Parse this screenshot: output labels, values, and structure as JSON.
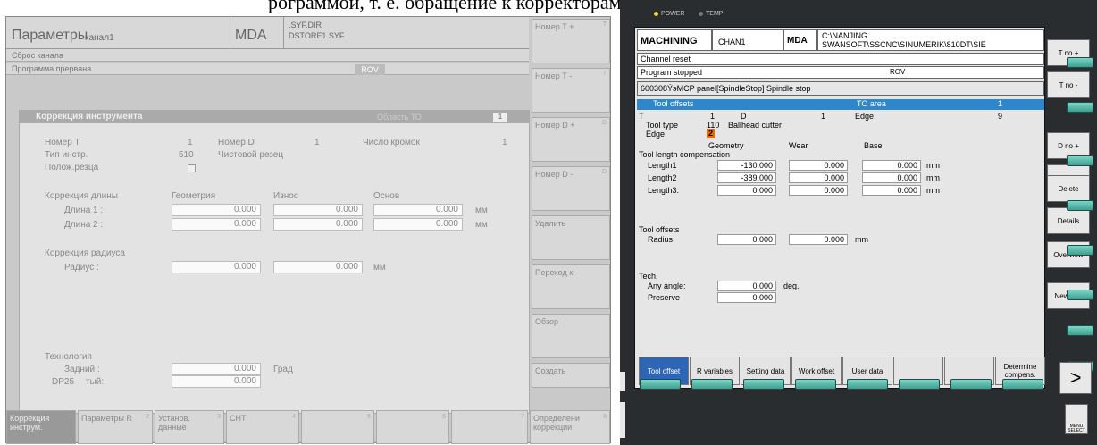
{
  "caption": {
    "text": "рограммой, т. е. обращение к корректорам инструмента и обратно"
  },
  "left": {
    "title": "Параметры",
    "channel": "канал1",
    "mode": "MDA",
    "path1": ".SYF.DIR",
    "path2": "DSTORE1.SYF",
    "row1": "Сброс канала",
    "row2": "Программа прервана",
    "rov": "ROV",
    "box_title": "Коррекция инструмента",
    "box_title_right": "Область ТО",
    "box_title_num": "1",
    "num_t_label": "Номер Т",
    "num_t": "1",
    "num_d_label": "Номер D",
    "num_d": "1",
    "edges_label": "Число кромок",
    "edges": "1",
    "tool_type_label": "Тип инстр.",
    "tool_type": "510",
    "tool_type_name": "Чистовой резец",
    "edge_pos_label": "Полож.резца",
    "len_label": "Коррекция длины",
    "col_geom": "Геометрия",
    "col_wear": "Износ",
    "col_base": "Основ",
    "len1_label": "Длина 1 :",
    "len1_geom": "0.000",
    "len1_wear": "0.000",
    "len1_base": "0.000",
    "len2_label": "Длина 2 :",
    "len2_geom": "0.000",
    "len2_wear": "0.000",
    "len2_base": "0.000",
    "unit": "мм",
    "radius_label": "Коррекция радиуса",
    "radius_sub": "Радиус :",
    "radius_geom": "0.000",
    "radius_wear": "0.000",
    "tech_label": "Технология",
    "tech_back": "Задний :",
    "tech_back_val": "0.000",
    "tech_unit": "Град",
    "tech_dp": "DP25",
    "tech_dp_sub": "тый:",
    "tech_dp_val": "0.000",
    "softkeys": [
      {
        "label": "Номер Т +",
        "n": "T"
      },
      {
        "label": "Номер Т -",
        "n": "T"
      },
      {
        "label": "Номер D +",
        "n": "D"
      },
      {
        "label": "Номер D -",
        "n": "D"
      },
      {
        "label": "Удалить",
        "n": ""
      },
      {
        "label": "Переход к",
        "n": ""
      },
      {
        "label": "Обзор",
        "n": ""
      },
      {
        "label": "Создать",
        "n": ""
      }
    ],
    "bottom": [
      {
        "label": "Коррекция инструм.",
        "n": "1"
      },
      {
        "label": "Параметры R",
        "n": "2"
      },
      {
        "label": "Установ. данные",
        "n": "3"
      },
      {
        "label": "СНТ",
        "n": "4"
      },
      {
        "label": "",
        "n": "5"
      },
      {
        "label": "",
        "n": "6"
      },
      {
        "label": "",
        "n": "7"
      },
      {
        "label": "Определени коррекции",
        "n": "8"
      }
    ]
  },
  "right": {
    "led_power": "POWER",
    "led_temp": "TEMP",
    "mode": "MACHINING",
    "channel": "CHAN1",
    "mda": "MDA",
    "path1": "C:\\NANJING",
    "path2": "SWANSOFT\\SSCNC\\SINUMERIK\\810DT\\SIE",
    "row1": "Channel reset",
    "row2": "Program stopped",
    "rov": "ROV",
    "alarm": "600308ÝэMCP panel[SpindleStop] Spindle stop",
    "title": "Tool offsets",
    "to_area": "TO area",
    "to_num": "1",
    "t_label": "T",
    "t_val": "1",
    "d_label": "D",
    "d_val": "1",
    "edge_label": "Edge",
    "edge_val": "9",
    "tool_type_label": "Tool type",
    "tool_type": "110",
    "tool_type_name": "Ballhead cutter",
    "edge2_label": "Edge",
    "edge2_val": "2",
    "col_geom": "Geometry",
    "col_wear": "Wear",
    "col_base": "Base",
    "tlc_label": "Tool length compensation",
    "length1_label": "Length1",
    "length1_geom": "-130.000",
    "length1_wear": "0.000",
    "length1_base": "0.000",
    "length2_label": "Length2",
    "length2_geom": "-389.000",
    "length2_wear": "0.000",
    "length2_base": "0.000",
    "length3_label": "Length3:",
    "length3_geom": "0.000",
    "length3_wear": "0.000",
    "length3_base": "0.000",
    "unit": "mm",
    "to2_label": "Tool offsets",
    "radius_label": "Radius",
    "radius_geom": "0.000",
    "radius_wear": "0.000",
    "tech_label": "Tech.",
    "any_angle_label": "Any angle:",
    "any_angle_val": "0.000",
    "deg": "deg.",
    "preserve_label": "Preserve",
    "preserve_val": "0.000",
    "softkeys": [
      "T no +",
      "T no -",
      "D no +",
      "D no -",
      "Delete",
      "Details",
      "Overview",
      "New tool"
    ],
    "bottom": [
      "Tool offset",
      "R variables",
      "Setting data",
      "Work offset",
      "User data",
      "",
      "",
      "Determine compens."
    ],
    "arrow": ">",
    "menu_select": "MENU SELECT"
  }
}
